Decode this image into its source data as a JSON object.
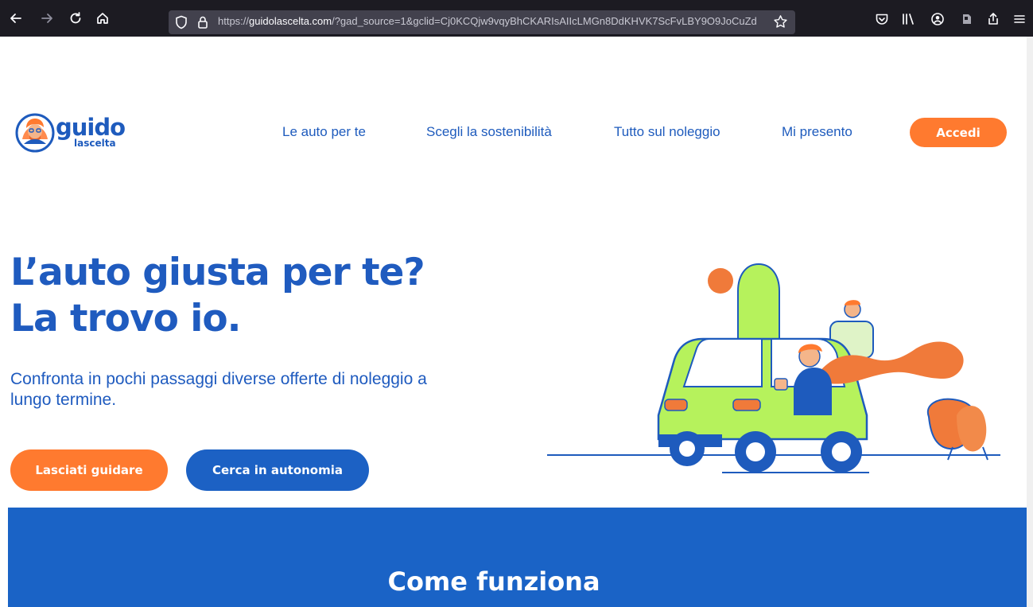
{
  "browser": {
    "url_prefix": "https://",
    "url_host": "guidolascelta.com",
    "url_rest": "/?gad_source=1&gclid=Cj0KCQjw9vqyBhCKARIsAIIcLMGn8DdKHVK7ScFvLBY9O9JoCuZd"
  },
  "site": {
    "logo_word": "guido",
    "logo_sub": "lascelta",
    "nav": [
      {
        "label": "Le auto per te"
      },
      {
        "label": "Scegli la sostenibilità"
      },
      {
        "label": "Tutto sul noleggio"
      },
      {
        "label": "Mi presento"
      }
    ],
    "login_label": "Accedi"
  },
  "hero": {
    "title_line1": "L’auto giusta per te?",
    "title_line2": "La trovo io.",
    "subtitle": "Confronta in pochi passaggi diverse offerte di noleggio a lungo termine.",
    "cta_primary": "Lasciati guidare",
    "cta_secondary": "Cerca in autonomia"
  },
  "section": {
    "title": "Come funziona"
  },
  "colors": {
    "brand_blue": "#1e5bbd",
    "accent_orange": "#ff7a2f",
    "car_green": "#b6f25c",
    "browser_dark": "#1c1b22"
  },
  "icons": [
    "back-arrow-icon",
    "forward-arrow-icon",
    "reload-icon",
    "home-icon",
    "shield-icon",
    "lock-icon",
    "star-icon",
    "pocket-icon",
    "library-icon",
    "account-icon",
    "extension-icon",
    "share-icon",
    "menu-icon"
  ]
}
